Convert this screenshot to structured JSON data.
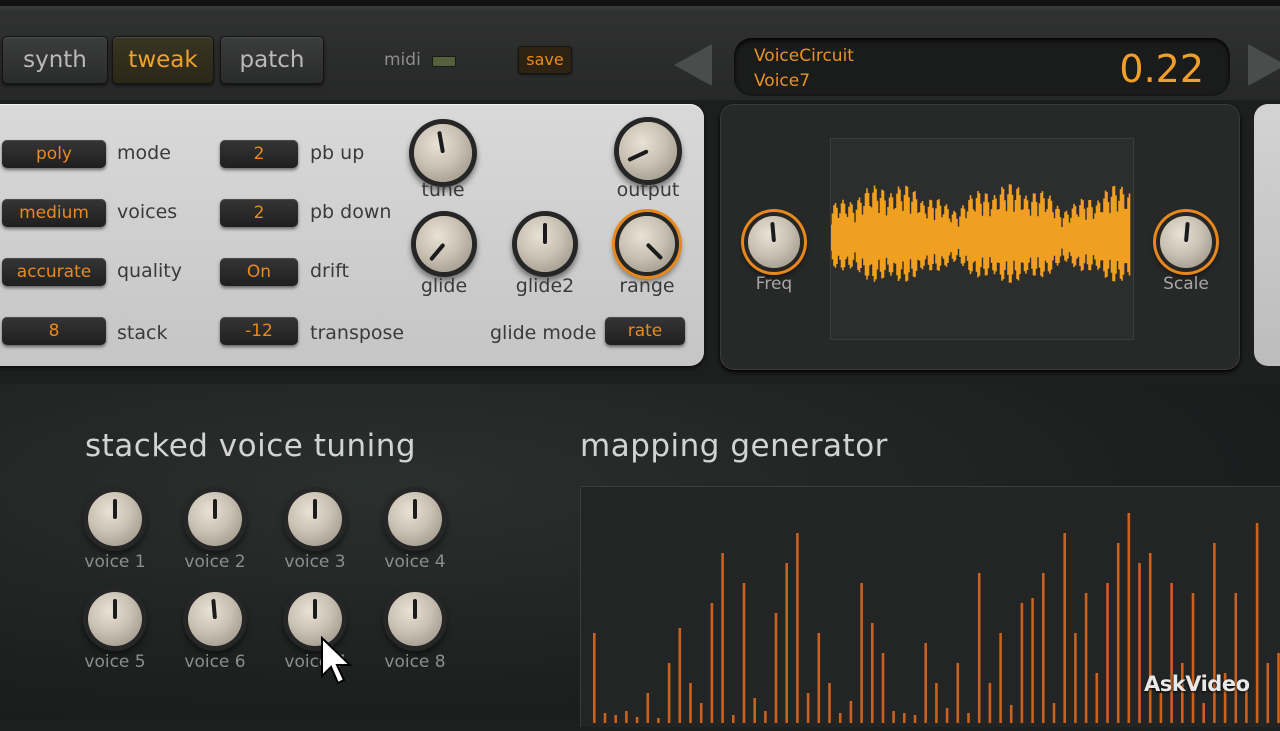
{
  "tabs": [
    {
      "label": "synth",
      "active": false
    },
    {
      "label": "tweak",
      "active": true
    },
    {
      "label": "patch",
      "active": false
    }
  ],
  "midi": {
    "label": "midi"
  },
  "save": {
    "label": "save"
  },
  "preset": {
    "bank": "VoiceCircuit",
    "name": "Voice7",
    "value": "0.22"
  },
  "settings": {
    "mode": {
      "value": "poly",
      "label": "mode"
    },
    "voices": {
      "value": "medium",
      "label": "voices"
    },
    "quality": {
      "value": "accurate",
      "label": "quality"
    },
    "stack": {
      "value": "8",
      "label": "stack"
    },
    "pb_up": {
      "value": "2",
      "label": "pb up"
    },
    "pb_down": {
      "value": "2",
      "label": "pb down"
    },
    "drift": {
      "value": "On",
      "label": "drift"
    },
    "transpose": {
      "value": "-12",
      "label": "transpose"
    },
    "glide_mode": {
      "value": "rate",
      "label": "glide mode"
    }
  },
  "knobs": {
    "tune": "tune",
    "output": "output",
    "glide": "glide",
    "glide2": "glide2",
    "range": "range",
    "freq": "Freq",
    "scale": "Scale"
  },
  "stacked": {
    "title": "stacked voice tuning",
    "voices": [
      "voice 1",
      "voice 2",
      "voice 3",
      "voice 4",
      "voice 5",
      "voice 6",
      "voice 7",
      "voice 8"
    ]
  },
  "mapping": {
    "title": "mapping generator"
  },
  "watermark": "AskVideo",
  "colors": {
    "accent": "#e98a1e",
    "waveform": "#f0a020",
    "bars": "#c8621e"
  },
  "icons": {
    "prev": "triangle-left-icon",
    "next": "triangle-right-icon",
    "cursor": "mouse-pointer-icon"
  }
}
